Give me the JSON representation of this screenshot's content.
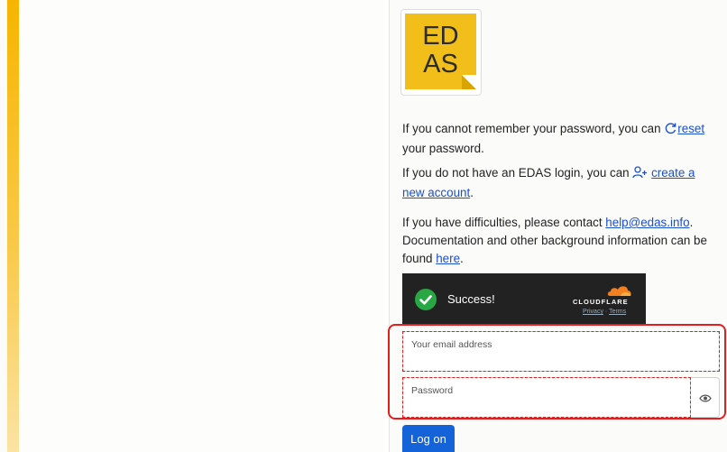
{
  "logo": {
    "line1": "ED",
    "line2": "AS"
  },
  "help": {
    "p1_before": "If you cannot remember your password, you can ",
    "p1_link": "reset",
    "p1_after": "your password.",
    "p2_before": "If you do not have an EDAS login, you can ",
    "p2_link": "create a new account",
    "p2_after": ".",
    "p3_before": "If you have difficulties, please contact ",
    "p3_email": "help@edas.info",
    "p3_mid": ". Documentation and other background information can be found ",
    "p3_here": "here",
    "p3_after": "."
  },
  "captcha": {
    "status": "Success!",
    "brand": "CLOUDFLARE",
    "privacy": "Privacy",
    "sep": " · ",
    "terms": "Terms"
  },
  "form": {
    "email_placeholder": "Your email address",
    "password_placeholder": "Password",
    "submit_label": "Log on"
  },
  "icons": [
    "reset-icon",
    "add-user-icon",
    "check-icon",
    "cloudflare-cloud-icon",
    "eye-icon"
  ],
  "colors": {
    "accent": "#f7b500",
    "link": "#1a4fd0",
    "primary_button": "#1463d8",
    "highlight": "#e41d1d",
    "success": "#29a745"
  }
}
